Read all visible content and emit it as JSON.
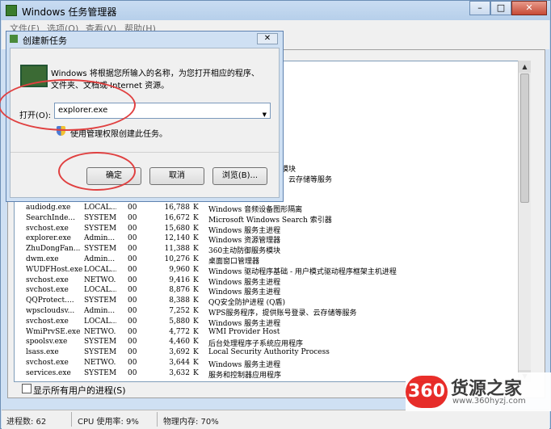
{
  "window": {
    "title": "Windows 任务管理器",
    "min": "–",
    "max": "□",
    "close": "✕"
  },
  "menu": [
    "文件(F)",
    "选项(O)",
    "查看(V)",
    "帮助(H)"
  ],
  "processes": [
    {
      "image": "audiodg.exe",
      "user": "LOCAL...",
      "cpu": "00",
      "mem": "16,788",
      "desc": "Windows 音频设备图形隔离"
    },
    {
      "image": "SearchInde...",
      "user": "SYSTEM",
      "cpu": "00",
      "mem": "16,672",
      "desc": "Microsoft Windows Search 索引器"
    },
    {
      "image": "svchost.exe",
      "user": "SYSTEM",
      "cpu": "00",
      "mem": "15,680",
      "desc": "Windows 服务主进程"
    },
    {
      "image": "explorer.exe",
      "user": "Admin...",
      "cpu": "00",
      "mem": "12,140",
      "desc": "Windows 资源管理器"
    },
    {
      "image": "ZhuDongFan...",
      "user": "SYSTEM",
      "cpu": "00",
      "mem": "11,388",
      "desc": "360主动防御服务模块"
    },
    {
      "image": "dwm.exe",
      "user": "Admin...",
      "cpu": "00",
      "mem": "10,276",
      "desc": "桌面窗口管理器"
    },
    {
      "image": "WUDFHost.exe",
      "user": "LOCAL...",
      "cpu": "00",
      "mem": "9,960",
      "desc": "Windows 驱动程序基础 - 用户模式驱动程序框架主机进程"
    },
    {
      "image": "svchost.exe",
      "user": "NETWO...",
      "cpu": "00",
      "mem": "9,416",
      "desc": "Windows 服务主进程"
    },
    {
      "image": "svchost.exe",
      "user": "LOCAL...",
      "cpu": "00",
      "mem": "8,876",
      "desc": "Windows 服务主进程"
    },
    {
      "image": "QQProtect....",
      "user": "SYSTEM",
      "cpu": "00",
      "mem": "8,388",
      "desc": "QQ安全防护进程 (Q盾)"
    },
    {
      "image": "wpscloudsv...",
      "user": "Admin...",
      "cpu": "00",
      "mem": "7,252",
      "desc": "WPS服务程序，提供账号登录、云存储等服务"
    },
    {
      "image": "svchost.exe",
      "user": "LOCAL...",
      "cpu": "00",
      "mem": "5,880",
      "desc": "Windows 服务主进程"
    },
    {
      "image": "WmiPrvSE.exe",
      "user": "NETWO...",
      "cpu": "00",
      "mem": "4,772",
      "desc": "WMI Provider Host"
    },
    {
      "image": "spoolsv.exe",
      "user": "SYSTEM",
      "cpu": "00",
      "mem": "4,460",
      "desc": "后台处理程序子系统应用程序"
    },
    {
      "image": "lsass.exe",
      "user": "SYSTEM",
      "cpu": "00",
      "mem": "3,692",
      "desc": "Local Security Authority Process"
    },
    {
      "image": "svchost.exe",
      "user": "NETWO...",
      "cpu": "00",
      "mem": "3,644",
      "desc": "Windows 服务主进程"
    },
    {
      "image": "services.exe",
      "user": "SYSTEM",
      "cpu": "00",
      "mem": "3,632",
      "desc": "服务和控制器应用程序"
    }
  ],
  "mem_unit": "K",
  "peek": {
    "line1": "模块",
    "line2": "、云存储等服务"
  },
  "show_all_label": "显示所有用户的进程(S)",
  "status": {
    "processes": "进程数: 62",
    "cpu": "CPU 使用率: 9%",
    "memory": "物理内存: 70%"
  },
  "dialog": {
    "title": "创建新任务",
    "close": "✕",
    "desc_line1": "Windows 将根据您所输入的名称，为您打开相应的程序、",
    "desc_line2": "文件夹、文档或 Internet 资源。",
    "open_label": "打开(O):",
    "open_value": "explorer.exe",
    "admin_note": "使用管理权限创建此任务。",
    "ok": "确定",
    "cancel": "取消",
    "browse": "浏览(B)..."
  },
  "watermark": {
    "logo": "360",
    "text": "货源之家",
    "url": "www.360hyzj.com"
  },
  "colors": {
    "window_frame": "#cfe0f3",
    "annotation_red": "#e04040",
    "watermark_red": "#e8231f"
  }
}
